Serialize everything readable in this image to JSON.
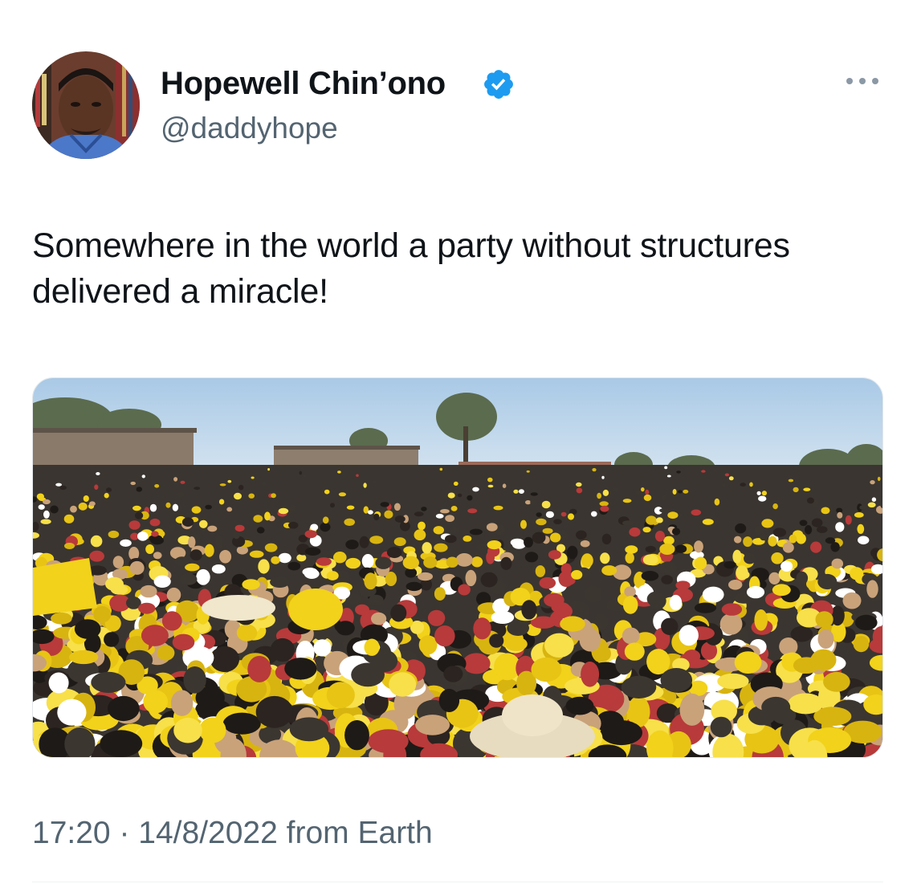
{
  "tweet": {
    "author": {
      "display_name": "Hopewell Chin’ono",
      "handle": "@daddyhope",
      "verified": true,
      "avatar_icon": "profile-photo"
    },
    "more_icon": "ellipsis-icon",
    "text": "Somewhere in the world a party without structures delivered a miracle!",
    "media_icon": "photo-crowd-in-yellow",
    "time": "17:20",
    "separator": "·",
    "date": "14/8/2022",
    "source": "from Earth"
  },
  "colors": {
    "text_primary": "#0f1419",
    "text_secondary": "#536471",
    "verified_blue": "#1d9bf0",
    "accent_yellow": "#f2d21a"
  }
}
